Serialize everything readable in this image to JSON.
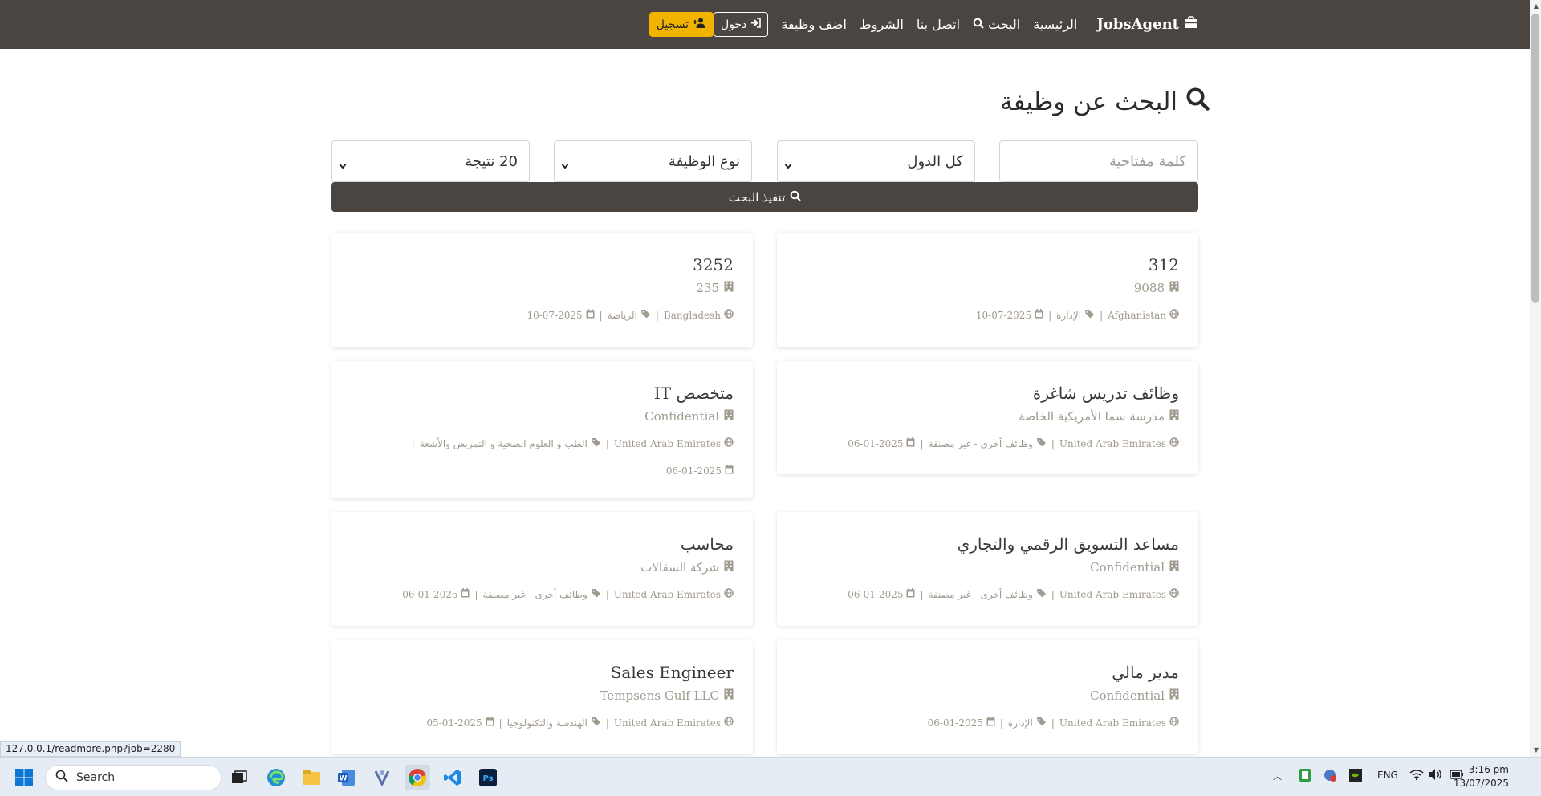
{
  "navbar": {
    "brand": "JobsAgent",
    "links": [
      "الرئيسية",
      "البحث",
      "اتصل بنا",
      "الشروط",
      "اضف وظيفة"
    ],
    "login": "دخول",
    "register": "تسجيل"
  },
  "page": {
    "title": "البحث عن وظيفة"
  },
  "filters": {
    "keyword_placeholder": "كلمة مفتاحية",
    "country": "كل الدول",
    "job_type": "نوع الوظيفة",
    "results": "20 نتيجة",
    "search_button": "تنفيذ البحث"
  },
  "jobs": [
    {
      "title": "312",
      "company": "9088",
      "country": "Afghanistan",
      "category": "الإدارة",
      "date": "10-07-2025"
    },
    {
      "title": "3252",
      "company": "235",
      "country": "Bangladesh",
      "category": "الرياضة",
      "date": "10-07-2025"
    },
    {
      "title": "وظائف تدريس شاغرة",
      "company": "مدرسة سما الأمريكية الخاصة",
      "country": "United Arab Emirates",
      "category": "وظائف أخرى - غير مصنفة",
      "date": "06-01-2025"
    },
    {
      "title": "متخصص IT",
      "company": "Confidential",
      "country": "United Arab Emirates",
      "category": "الطب و العلوم الصحية و التمريض والأشعة",
      "date": "06-01-2025"
    },
    {
      "title": "مساعد التسويق الرقمي والتجاري",
      "company": "Confidential",
      "country": "United Arab Emirates",
      "category": "وظائف أخرى - غير مصنفة",
      "date": "06-01-2025"
    },
    {
      "title": "محاسب",
      "company": "شركة السقالات",
      "country": "United Arab Emirates",
      "category": "وظائف أخرى - غير مصنفة",
      "date": "06-01-2025"
    },
    {
      "title": "مدير مالي",
      "company": "Confidential",
      "country": "United Arab Emirates",
      "category": "الإدارة",
      "date": "06-01-2025"
    },
    {
      "title": "Sales Engineer",
      "company": "Tempsens Gulf LLC",
      "country": "United Arab Emirates",
      "category": "الهندسة والتكنولوجيا",
      "date": "05-01-2025"
    }
  ],
  "status_bar": {
    "url": "127.0.0.1/readmore.php?job=2280"
  },
  "taskbar": {
    "search_placeholder": "Search",
    "language": "ENG",
    "time": "3:16 pm",
    "date": "13/07/2025"
  },
  "colors": {
    "navbar_bg": "#4a4541",
    "register_btn": "#f0b400",
    "muted_text": "#a19a8f"
  }
}
